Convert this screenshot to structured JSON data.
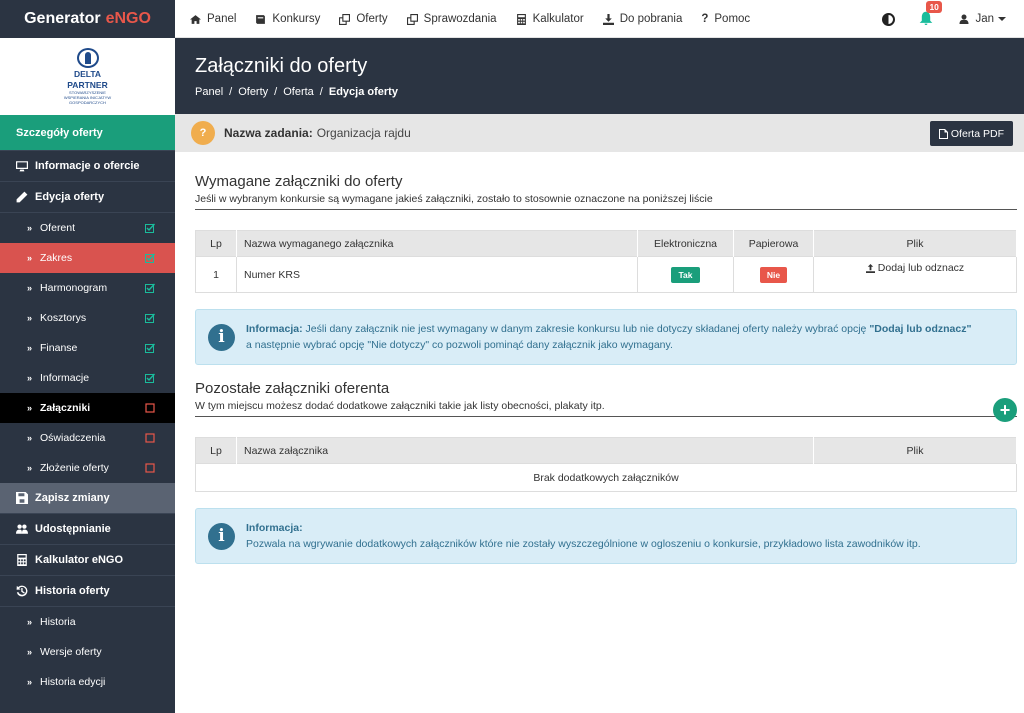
{
  "brand": {
    "name": "Generator",
    "accent": "eNGO"
  },
  "nav": [
    {
      "label": "Panel",
      "icon": "home-icon"
    },
    {
      "label": "Konkursy",
      "icon": "book-icon"
    },
    {
      "label": "Oferty",
      "icon": "copy-icon"
    },
    {
      "label": "Sprawozdania",
      "icon": "copy-icon"
    },
    {
      "label": "Kalkulator",
      "icon": "calculator-icon"
    },
    {
      "label": "Do pobrania",
      "icon": "download-icon"
    },
    {
      "label": "Pomoc",
      "icon": "question-icon"
    }
  ],
  "topbar": {
    "notifications": "10",
    "user": "Jan"
  },
  "logo": {
    "line1": "DELTA",
    "line2": "PARTNER",
    "sub": "STOWARZYSZENIE WSPIERANIA INICJATYW GOSPODARCZYCH"
  },
  "sidebar": {
    "header": "Szczegóły oferty",
    "info": "Informacje o ofercie",
    "edit": "Edycja oferty",
    "subs": [
      {
        "label": "Oferent",
        "status": "done"
      },
      {
        "label": "Zakres",
        "status": "done"
      },
      {
        "label": "Harmonogram",
        "status": "done"
      },
      {
        "label": "Kosztorys",
        "status": "done"
      },
      {
        "label": "Finanse",
        "status": "done"
      },
      {
        "label": "Informacje",
        "status": "done"
      },
      {
        "label": "Załączniki",
        "status": "todo"
      },
      {
        "label": "Oświadczenia",
        "status": "todo"
      },
      {
        "label": "Złożenie oferty",
        "status": "todo"
      }
    ],
    "save": "Zapisz zmiany",
    "share": "Udostępnianie",
    "calc": "Kalkulator eNGO",
    "history": "Historia oferty",
    "history_subs": [
      "Historia",
      "Wersje oferty",
      "Historia edycji"
    ]
  },
  "header": {
    "title": "Załączniki do oferty",
    "crumbs": [
      "Panel",
      "Oferty",
      "Oferta",
      "Edycja oferty"
    ]
  },
  "task": {
    "label": "Nazwa zadania:",
    "value": "Organizacja rajdu",
    "pdf": "Oferta PDF",
    "q": "?"
  },
  "required": {
    "title": "Wymagane załączniki do oferty",
    "desc": "Jeśli w wybranym konkursie są wymagane jakieś załączniki, zostało to stosownie oznaczone na poniższej liście",
    "cols": [
      "Lp",
      "Nazwa wymaganego załącznika",
      "Elektroniczna",
      "Papierowa",
      "Plik"
    ],
    "rows": [
      {
        "lp": "1",
        "name": "Numer KRS",
        "electronic": "Tak",
        "paper": "Nie",
        "file": "Dodaj lub odznacz"
      }
    ],
    "info_label": "Informacja:",
    "info_text1": "Jeśli dany załącznik nie jest wymagany w danym zakresie konkursu lub nie dotyczy składanej oferty należy wybrać opcję",
    "info_bold": "\"Dodaj lub odznacz\"",
    "info_text2": "a następnie wybrać opcję \"Nie dotyczy\" co pozwoli pominąć dany załącznik jako wymagany."
  },
  "other": {
    "title": "Pozostałe załączniki oferenta",
    "desc": "W tym miejscu możesz dodać dodatkowe załączniki takie jak listy obecności, plakaty itp.",
    "cols": [
      "Lp",
      "Nazwa załącznika",
      "Plik"
    ],
    "empty": "Brak dodatkowych załączników",
    "plus": "+",
    "info_label": "Informacja:",
    "info_text": "Pozwala na wgrywanie dodatkowych załączników które nie zostały wyszczególnione w ogloszeniu o konkursie, przykładowo lista zawodników itp."
  },
  "colors": {
    "dark": "#2b3442",
    "green": "#1a9e7b",
    "red": "#e8574a",
    "info_bg": "#d9edf7"
  }
}
